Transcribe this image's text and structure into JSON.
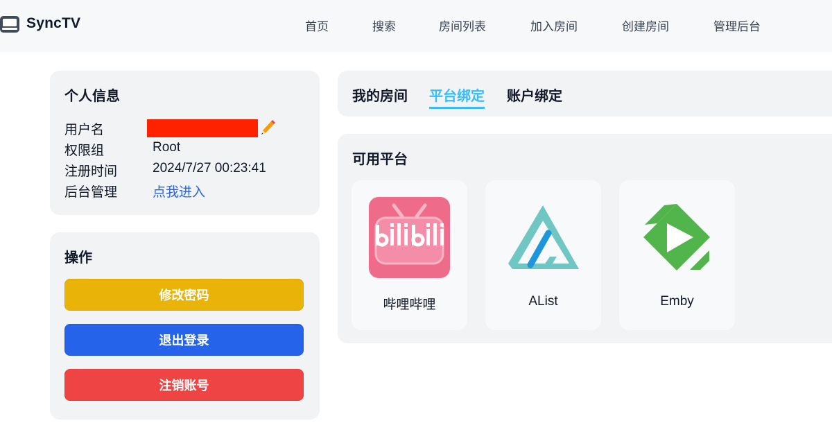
{
  "app": {
    "brand": "SyncTV"
  },
  "nav": {
    "items": [
      "首页",
      "搜索",
      "房间列表",
      "加入房间",
      "创建房间",
      "管理后台"
    ]
  },
  "profile": {
    "title": "个人信息",
    "rows": [
      {
        "label": "用户名",
        "value": ""
      },
      {
        "label": "权限组",
        "value": "Root"
      },
      {
        "label": "注册时间",
        "value": "2024/7/27 00:23:41"
      },
      {
        "label": "后台管理",
        "value": "点我进入"
      }
    ],
    "username_redacted_color": "#ff2200"
  },
  "actions": {
    "title": "操作",
    "change_password": "修改密码",
    "logout": "退出登录",
    "delete_account": "注销账号",
    "colors": {
      "change_password": "#eab308",
      "logout": "#2563eb",
      "delete_account": "#ef4444"
    }
  },
  "tabs": {
    "items": [
      "我的房间",
      "平台绑定",
      "账户绑定"
    ],
    "active_index": 1,
    "accent": "#38bdf8"
  },
  "platforms": {
    "title": "可用平台",
    "items": [
      {
        "name": "哔哩哔哩",
        "icon": "bilibili-logo"
      },
      {
        "name": "AList",
        "icon": "alist-logo"
      },
      {
        "name": "Emby",
        "icon": "emby-logo"
      }
    ]
  }
}
